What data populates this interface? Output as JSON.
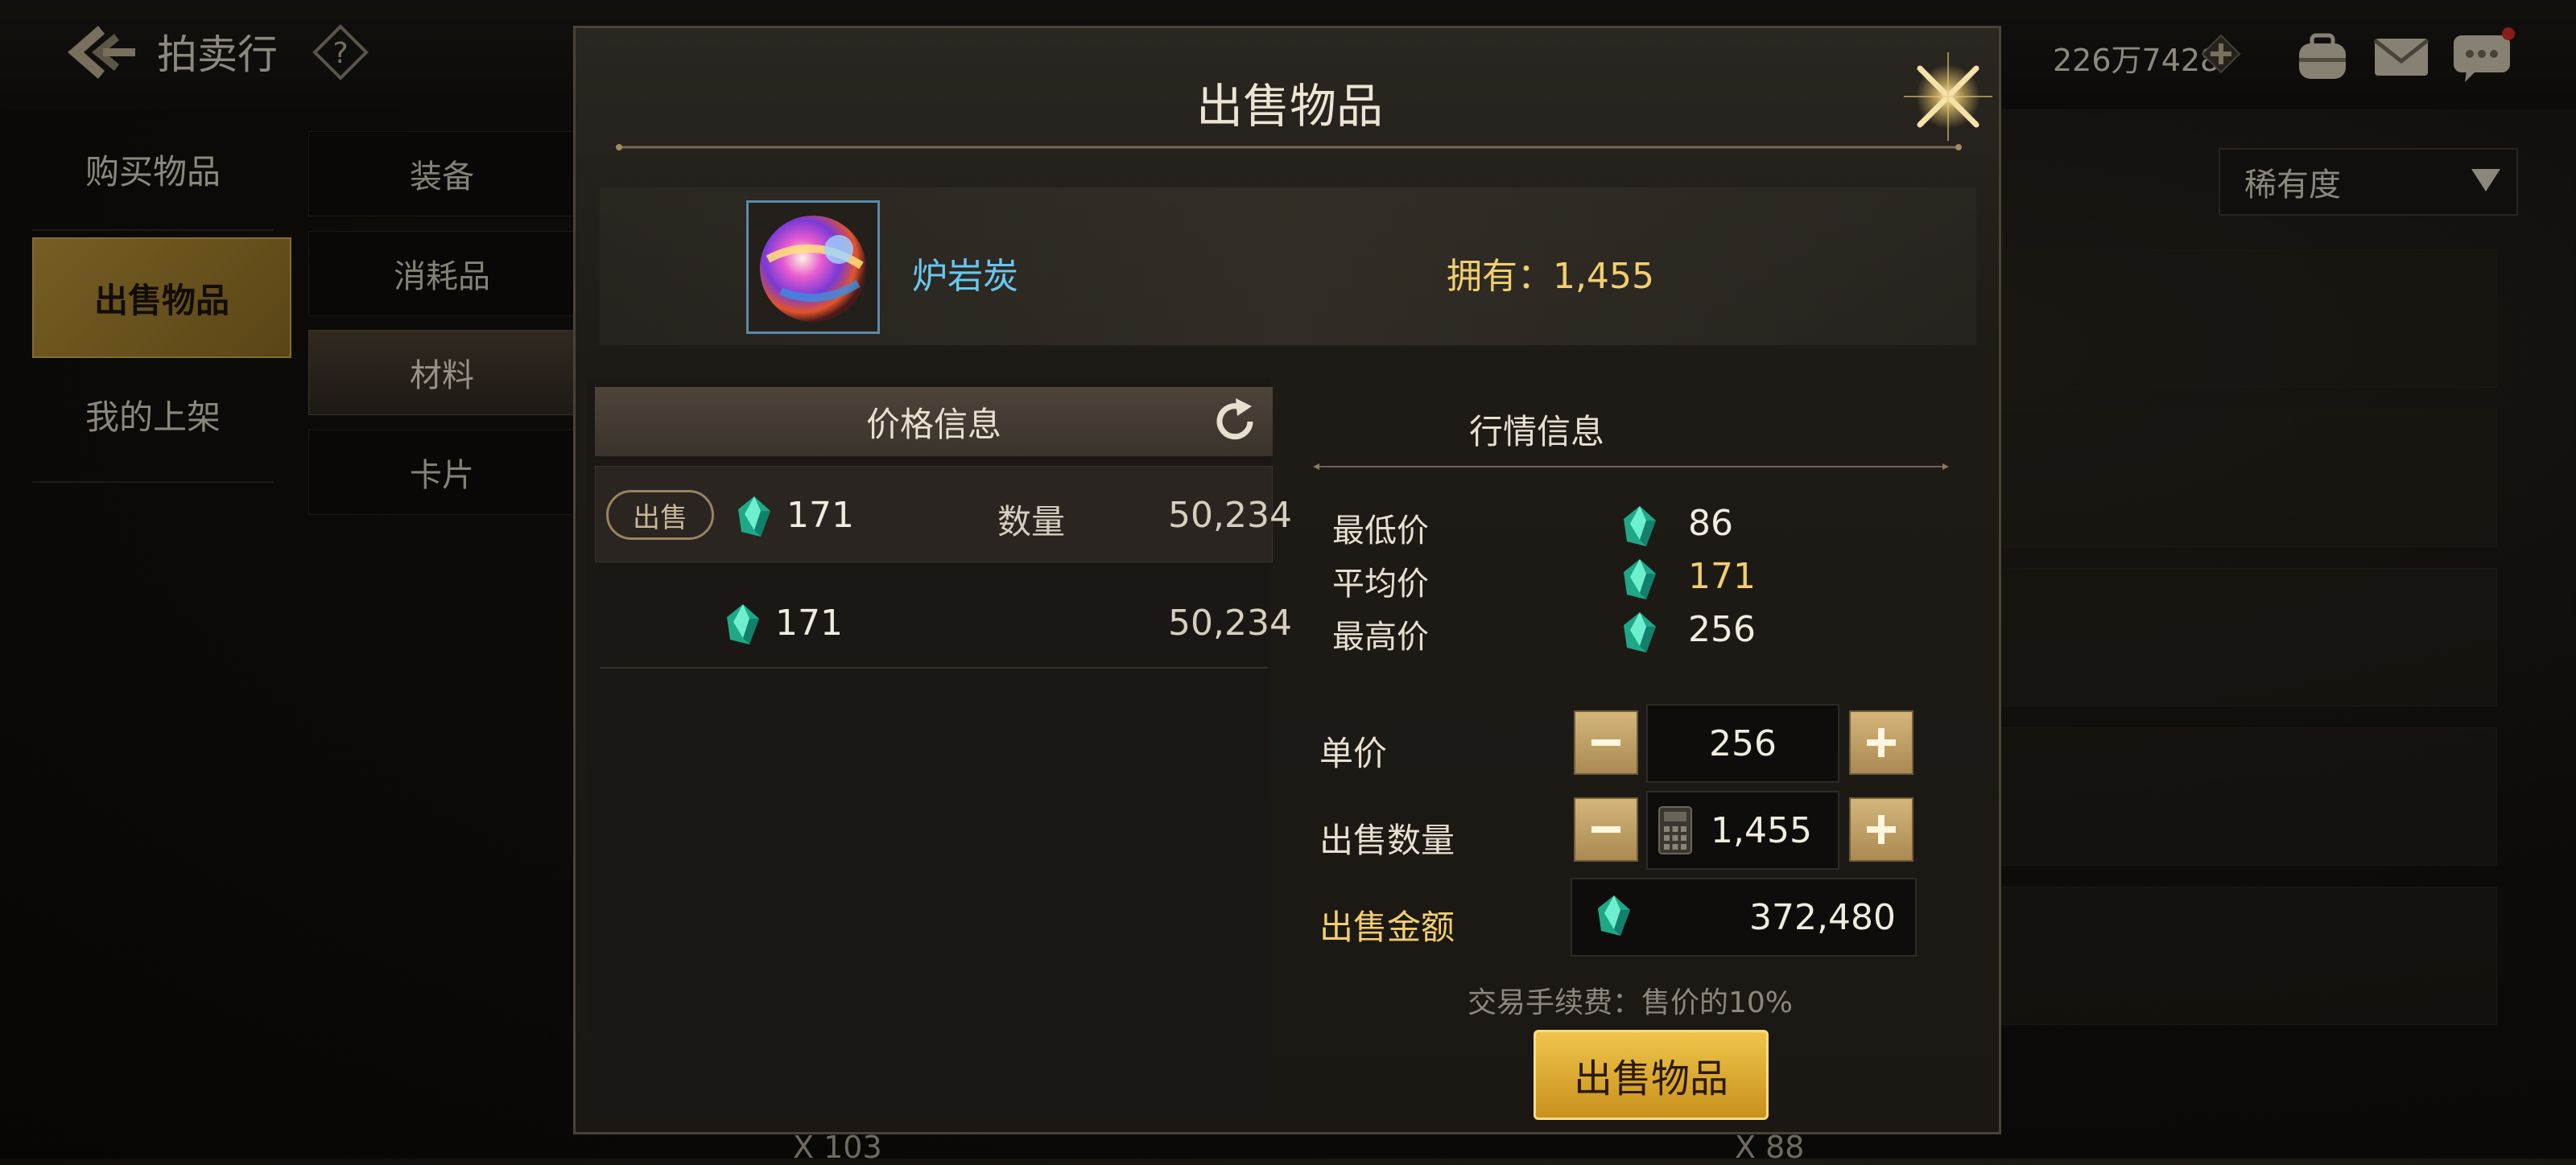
{
  "header": {
    "title": "拍卖行",
    "help_icon": "question-icon",
    "currency_amount": "226万7428",
    "icons": [
      "back-arrow-icon",
      "plus-icon",
      "bag-icon",
      "mail-icon",
      "chat-icon"
    ]
  },
  "left_nav": {
    "buy": "购买物品",
    "sell": "出售物品",
    "my_listings": "我的上架"
  },
  "categories": {
    "equipment": "装备",
    "consumables": "消耗品",
    "materials": "材料",
    "cards": "卡片"
  },
  "filter": {
    "rarity": "稀有度"
  },
  "background": {
    "count_left": "X 103",
    "count_right": "X 88"
  },
  "modal": {
    "title": "出售物品",
    "item": {
      "name": "炉岩炭",
      "owned": "拥有：1,455"
    },
    "price_info": {
      "header": "价格信息",
      "rows": [
        {
          "tag": "出售",
          "price": "171",
          "qty_label": "数量",
          "qty": "50,234"
        },
        {
          "price": "171",
          "qty": "50,234"
        }
      ]
    },
    "market_info": {
      "header": "行情信息",
      "min_label": "最低价",
      "min": "86",
      "avg_label": "平均价",
      "avg": "171",
      "max_label": "最高价",
      "max": "256"
    },
    "form": {
      "unit_price_label": "单价",
      "unit_price": "256",
      "quantity_label": "出售数量",
      "quantity": "1,455",
      "total_label": "出售金额",
      "total": "372,480",
      "fee_note": "交易手续费：售价的10%",
      "submit": "出售物品"
    }
  },
  "colors": {
    "gold": "#f2cf6e",
    "item_name": "#69c7f0",
    "gem": "#2fd3a6",
    "button_gold": "#e0ad2f"
  }
}
